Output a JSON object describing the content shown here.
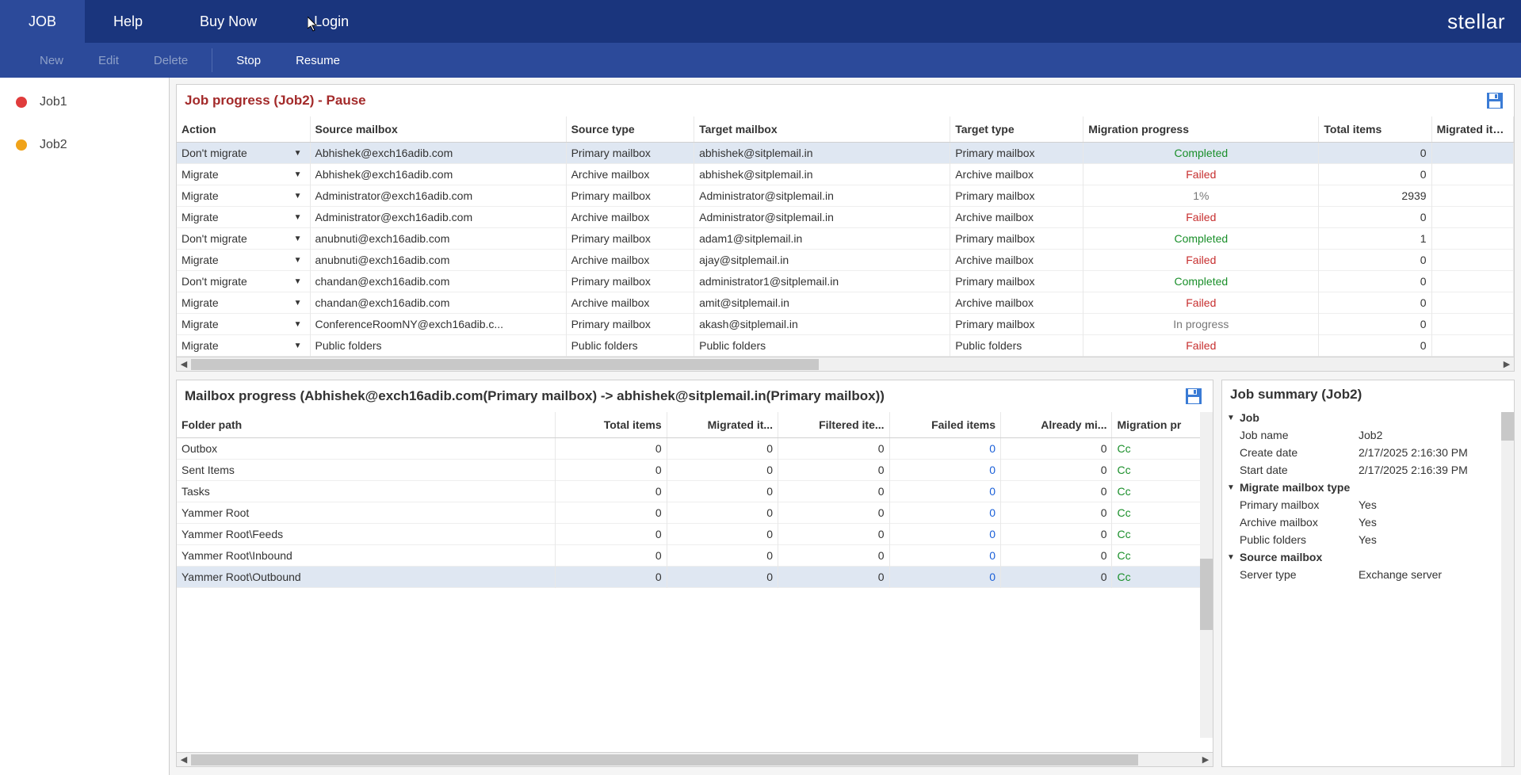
{
  "menu": {
    "tabs": [
      "JOB",
      "Help",
      "Buy Now",
      "Login"
    ],
    "brand": "stellar"
  },
  "toolbar": {
    "new": "New",
    "edit": "Edit",
    "delete": "Delete",
    "stop": "Stop",
    "resume": "Resume"
  },
  "sidebar": {
    "items": [
      {
        "label": "Job1",
        "color": "#e03c3c",
        "hasBar": true
      },
      {
        "label": "Job2",
        "color": "#f0a31a",
        "hasBar": false
      }
    ]
  },
  "jobProgress": {
    "title": "Job progress (Job2) - Pause",
    "columns": [
      "Action",
      "Source mailbox",
      "Source type",
      "Target mailbox",
      "Target type",
      "Migration progress",
      "Total items",
      "Migrated items"
    ],
    "rows": [
      {
        "action": "Don't migrate",
        "src": "Abhishek@exch16adib.com",
        "stype": "Primary mailbox",
        "tgt": "abhishek@sitplemail.in",
        "ttype": "Primary mailbox",
        "prog": "Completed",
        "progClass": "status-completed",
        "total": "0",
        "mig": "",
        "sel": true
      },
      {
        "action": "Migrate",
        "src": "Abhishek@exch16adib.com",
        "stype": "Archive mailbox",
        "tgt": "abhishek@sitplemail.in",
        "ttype": "Archive mailbox",
        "prog": "Failed",
        "progClass": "status-failed",
        "total": "0",
        "mig": ""
      },
      {
        "action": "Migrate",
        "src": "Administrator@exch16adib.com",
        "stype": "Primary mailbox",
        "tgt": "Administrator@sitplemail.in",
        "ttype": "Primary mailbox",
        "prog": "1%",
        "progClass": "status-progress",
        "total": "2939",
        "mig": ""
      },
      {
        "action": "Migrate",
        "src": "Administrator@exch16adib.com",
        "stype": "Archive mailbox",
        "tgt": "Administrator@sitplemail.in",
        "ttype": "Archive mailbox",
        "prog": "Failed",
        "progClass": "status-failed",
        "total": "0",
        "mig": ""
      },
      {
        "action": "Don't migrate",
        "src": "anubnuti@exch16adib.com",
        "stype": "Primary mailbox",
        "tgt": "adam1@sitplemail.in",
        "ttype": "Primary mailbox",
        "prog": "Completed",
        "progClass": "status-completed",
        "total": "1",
        "mig": ""
      },
      {
        "action": "Migrate",
        "src": "anubnuti@exch16adib.com",
        "stype": "Archive mailbox",
        "tgt": "ajay@sitplemail.in",
        "ttype": "Archive mailbox",
        "prog": "Failed",
        "progClass": "status-failed",
        "total": "0",
        "mig": ""
      },
      {
        "action": "Don't migrate",
        "src": "chandan@exch16adib.com",
        "stype": "Primary mailbox",
        "tgt": "administrator1@sitplemail.in",
        "ttype": "Primary mailbox",
        "prog": "Completed",
        "progClass": "status-completed",
        "total": "0",
        "mig": ""
      },
      {
        "action": "Migrate",
        "src": "chandan@exch16adib.com",
        "stype": "Archive mailbox",
        "tgt": "amit@sitplemail.in",
        "ttype": "Archive mailbox",
        "prog": "Failed",
        "progClass": "status-failed",
        "total": "0",
        "mig": ""
      },
      {
        "action": "Migrate",
        "src": "ConferenceRoomNY@exch16adib.c...",
        "stype": "Primary mailbox",
        "tgt": "akash@sitplemail.in",
        "ttype": "Primary mailbox",
        "prog": "In progress",
        "progClass": "status-progress",
        "total": "0",
        "mig": ""
      },
      {
        "action": "Migrate",
        "src": "Public folders",
        "stype": "Public folders",
        "tgt": "Public folders",
        "ttype": "Public folders",
        "prog": "Failed",
        "progClass": "status-failed",
        "total": "0",
        "mig": ""
      }
    ]
  },
  "mailboxProgress": {
    "title": "Mailbox progress (Abhishek@exch16adib.com(Primary mailbox) -> abhishek@sitplemail.in(Primary mailbox))",
    "columns": [
      "Folder path",
      "Total items",
      "Migrated it...",
      "Filtered ite...",
      "Failed items",
      "Already mi...",
      "Migration pr"
    ],
    "rows": [
      {
        "path": "Outbox",
        "total": "0",
        "mig": "0",
        "filt": "0",
        "fail": "0",
        "already": "0",
        "prog": "Cc"
      },
      {
        "path": "Sent Items",
        "total": "0",
        "mig": "0",
        "filt": "0",
        "fail": "0",
        "already": "0",
        "prog": "Cc"
      },
      {
        "path": "Tasks",
        "total": "0",
        "mig": "0",
        "filt": "0",
        "fail": "0",
        "already": "0",
        "prog": "Cc"
      },
      {
        "path": "Yammer Root",
        "total": "0",
        "mig": "0",
        "filt": "0",
        "fail": "0",
        "already": "0",
        "prog": "Cc"
      },
      {
        "path": "Yammer Root\\Feeds",
        "total": "0",
        "mig": "0",
        "filt": "0",
        "fail": "0",
        "already": "0",
        "prog": "Cc"
      },
      {
        "path": "Yammer Root\\Inbound",
        "total": "0",
        "mig": "0",
        "filt": "0",
        "fail": "0",
        "already": "0",
        "prog": "Cc"
      },
      {
        "path": "Yammer Root\\Outbound",
        "total": "0",
        "mig": "0",
        "filt": "0",
        "fail": "0",
        "already": "0",
        "prog": "Cc",
        "sel": true
      }
    ]
  },
  "summary": {
    "title": "Job summary (Job2)",
    "groups": [
      {
        "name": "Job",
        "rows": [
          [
            "Job name",
            "Job2"
          ],
          [
            "Create date",
            "2/17/2025 2:16:30 PM"
          ],
          [
            "Start date",
            "2/17/2025 2:16:39 PM"
          ]
        ]
      },
      {
        "name": "Migrate mailbox type",
        "rows": [
          [
            "Primary mailbox",
            "Yes"
          ],
          [
            "Archive mailbox",
            "Yes"
          ],
          [
            "Public folders",
            "Yes"
          ]
        ]
      },
      {
        "name": "Source mailbox",
        "rows": [
          [
            "Server type",
            "Exchange server"
          ]
        ]
      }
    ]
  }
}
